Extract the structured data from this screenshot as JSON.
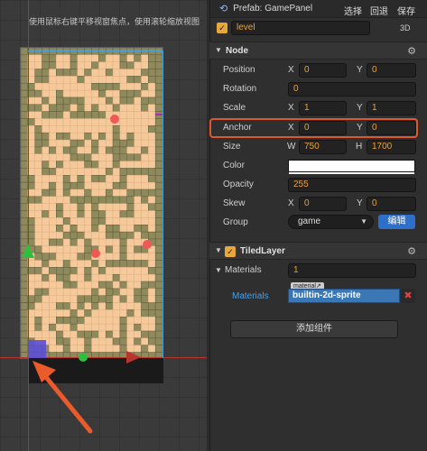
{
  "scene": {
    "hint": "使用鼠标右键平移视窗焦点，使用滚轮缩放视图"
  },
  "header": {
    "prefab_label": "Prefab: GamePanel",
    "select_btn": "选择",
    "revert_btn": "回退",
    "save_btn": "保存"
  },
  "node_name": {
    "value": "level",
    "mode": "3D"
  },
  "node_section": {
    "title": "Node",
    "position": {
      "label": "Position",
      "x": "0",
      "y": "0"
    },
    "rotation": {
      "label": "Rotation",
      "value": "0"
    },
    "scale": {
      "label": "Scale",
      "x": "1",
      "y": "1"
    },
    "anchor": {
      "label": "Anchor",
      "x": "0",
      "y": "0"
    },
    "size": {
      "label": "Size",
      "w_label": "W",
      "h_label": "H",
      "w": "750",
      "h": "1700"
    },
    "color": {
      "label": "Color",
      "value": "#FFFFFF"
    },
    "opacity": {
      "label": "Opacity",
      "value": "255"
    },
    "skew": {
      "label": "Skew",
      "x": "0",
      "y": "0"
    },
    "group": {
      "label": "Group",
      "value": "game",
      "edit_btn": "编辑"
    },
    "x_label": "X",
    "y_label": "Y"
  },
  "tiled_section": {
    "title": "TiledLayer",
    "materials_label": "Materials",
    "materials_count": "1",
    "material_tag": "material",
    "material_item_label": "Materials",
    "material_value": "builtin-2d-sprite"
  },
  "add_component": "添加组件",
  "colors": {
    "accent": "#E9A63A",
    "highlight": "#E0572E",
    "link": "#4A9FE8",
    "button_blue": "#2E6FC9"
  }
}
